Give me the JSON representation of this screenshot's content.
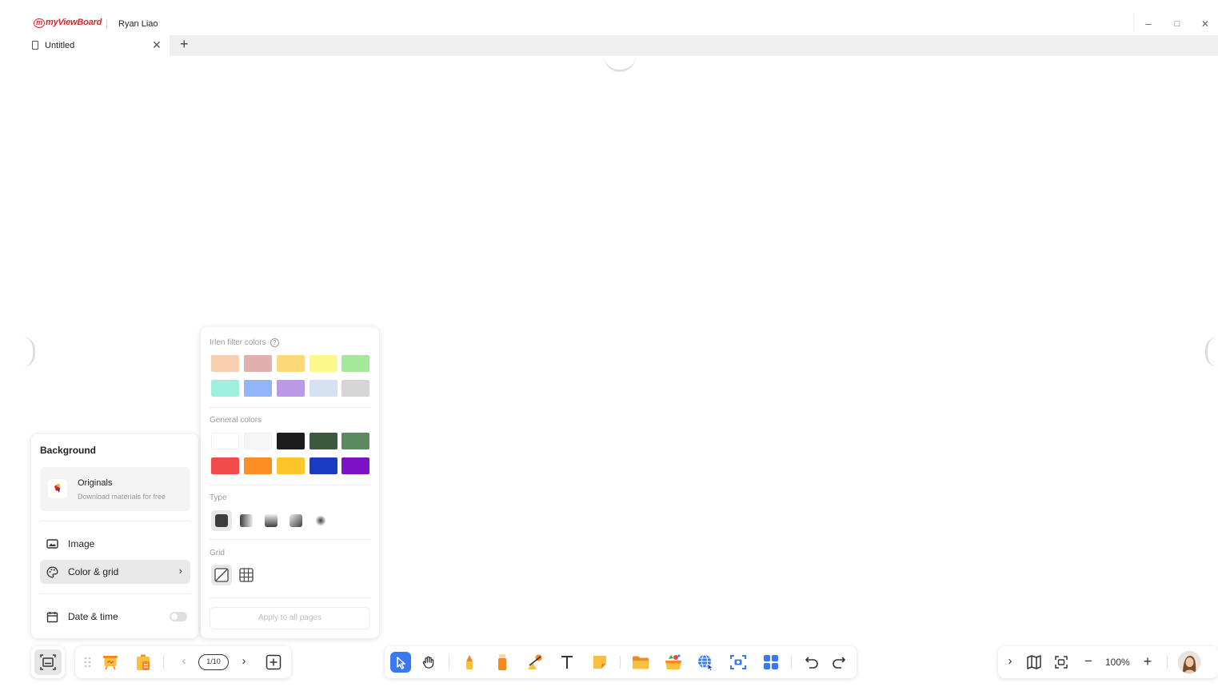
{
  "app": {
    "logo_text": "myViewBoard",
    "user_name": "Ryan Liao"
  },
  "window_controls": {
    "minimize": "–",
    "maximize": "□",
    "close": "✕"
  },
  "tabs": [
    {
      "title": "Untitled",
      "close": "✕"
    }
  ],
  "new_tab": "+",
  "background_panel": {
    "title": "Background",
    "originals": {
      "title": "Originals",
      "subtitle": "Download materials for free"
    },
    "items": [
      {
        "label": "Image"
      },
      {
        "label": "Color & grid",
        "chevron": "›"
      },
      {
        "label": "Date & time"
      }
    ]
  },
  "color_panel": {
    "irlen_label": "Irlen filter colors",
    "help_symbol": "?",
    "irlen_colors": [
      "#f8cfae",
      "#e1b0ae",
      "#fdd876",
      "#fcf889",
      "#a4e89a",
      "#9ef0dd",
      "#92b4f8",
      "#bc99e6",
      "#d6e1f2",
      "#d5d5d5"
    ],
    "general_label": "General colors",
    "general_colors": [
      "#ffffff",
      "#f6f6f6",
      "#1c1c1c",
      "#3b5a3e",
      "#5c8a60",
      "#f24b4b",
      "#fd8e25",
      "#fdc72c",
      "#1a3cc5",
      "#7b12c6"
    ],
    "type_label": "Type",
    "grid_label": "Grid",
    "apply_label": "Apply to all pages"
  },
  "pages_bar": {
    "prev": "‹",
    "next": "›",
    "page_indicator": "1/10"
  },
  "view_bar": {
    "expand": "›",
    "zoom_out": "−",
    "zoom_level": "100%",
    "zoom_in": "+"
  }
}
